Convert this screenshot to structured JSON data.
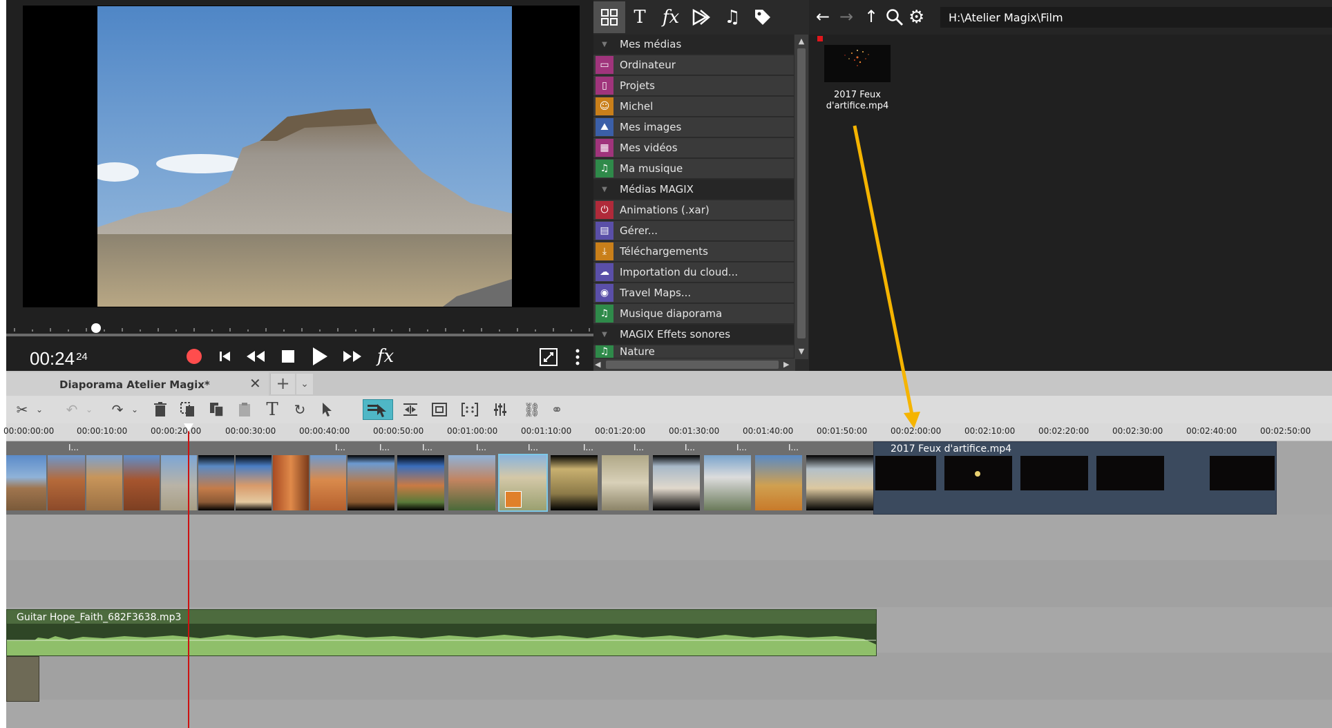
{
  "player": {
    "timecode": "00:24",
    "timecode_frames": "24"
  },
  "media_tabs": [
    "grid-icon",
    "text-icon",
    "fx-icon",
    "transitions-icon",
    "music-icon",
    "tag-icon"
  ],
  "tree": {
    "items": [
      {
        "label": "Mes médias",
        "header": true
      },
      {
        "label": "Ordinateur",
        "icon": "computer-icon",
        "color": "#a0347c"
      },
      {
        "label": "Projets",
        "icon": "document-icon",
        "color": "#a0347c"
      },
      {
        "label": "Michel",
        "icon": "user-icon",
        "color": "#c97f1a"
      },
      {
        "label": "Mes images",
        "icon": "image-icon",
        "color": "#3b5fa8"
      },
      {
        "label": "Mes vidéos",
        "icon": "film-icon",
        "color": "#a0347c"
      },
      {
        "label": "Ma musique",
        "icon": "music-icon",
        "color": "#2f8a4a"
      },
      {
        "label": "Médias MAGIX",
        "header": true
      },
      {
        "label": "Animations (.xar)",
        "icon": "power-icon",
        "color": "#b02a3a"
      },
      {
        "label": "Gérer...",
        "icon": "manage-icon",
        "color": "#5a4fa8"
      },
      {
        "label": "Téléchargements",
        "icon": "download-icon",
        "color": "#c97f1a"
      },
      {
        "label": "Importation du cloud...",
        "icon": "cloud-icon",
        "color": "#5a4fa8"
      },
      {
        "label": "Travel Maps...",
        "icon": "map-pin-icon",
        "color": "#5a4fa8"
      },
      {
        "label": "Musique diaporama",
        "icon": "music-icon",
        "color": "#2f8a4a"
      },
      {
        "label": "MAGIX Effets sonores",
        "header": true
      },
      {
        "label": "Nature",
        "icon": "music-icon",
        "color": "#2f8a4a"
      }
    ]
  },
  "browser": {
    "path": "H:\\Atelier Magix\\Film",
    "file_name": "2017 Feux d'artifice.mp4"
  },
  "project": {
    "tab_label": "Diaporama Atelier Magix*"
  },
  "ruler": {
    "ticks": [
      "00:00:00:00",
      "00:00:10:00",
      "00:00:20:00",
      "00:00:30:00",
      "00:00:40:00",
      "00:00:50:00",
      "00:01:00:00",
      "00:01:10:00",
      "00:01:20:00",
      "00:01:30:00",
      "00:01:40:00",
      "00:01:50:00",
      "00:02:00:00",
      "00:02:10:00",
      "00:02:20:00",
      "00:02:30:00",
      "00:02:40:00",
      "00:02:50:00"
    ]
  },
  "timeline": {
    "video_clip_label": "2017 Feux d'artifice.mp4",
    "audio_clip_label": "Guitar Hope_Faith_682F3638.mp3",
    "short_label": "I..."
  },
  "colors": {
    "accent": "#f5b400",
    "record": "#ff4d4d",
    "playhead": "#cc1111"
  }
}
